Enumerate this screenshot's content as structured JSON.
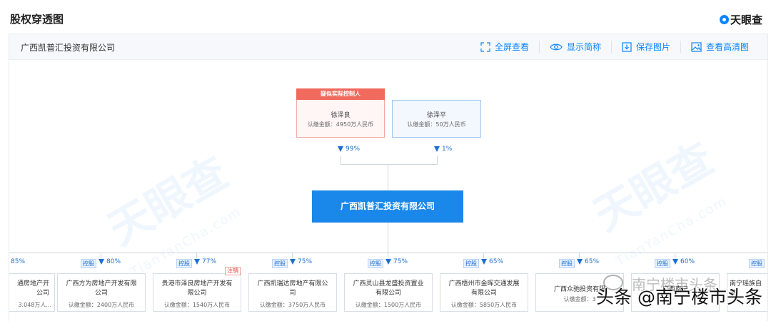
{
  "page": {
    "title": "股权穿透图",
    "brand": "天眼查"
  },
  "toolbar": {
    "company_name": "广西凯普汇投资有限公司",
    "fullscreen": "全屏查看",
    "show_abbr": "显示简称",
    "save_image": "保存图片",
    "hd_image": "查看高清图"
  },
  "watermarks": {
    "logo_text": "天眼查",
    "pinyin": "TianYanCha.com",
    "overlay": "头条 @南宁楼市头条",
    "ghost": "南宁楼市头条"
  },
  "shareholders": [
    {
      "tag": "疑似实际控制人",
      "name": "徐泽良",
      "amount": "认缴金额：4950万人民币",
      "percent": "99%"
    },
    {
      "name": "徐泽平",
      "amount": "认缴金额：50万人民币",
      "percent": "1%"
    }
  ],
  "main_company": {
    "name": "广西凯普汇投资有限公司"
  },
  "subsidiaries": {
    "control_label": "控股",
    "cancel_label": "注销",
    "items": [
      {
        "name": "通房地产开\n公司",
        "amount": "3.048万人...",
        "percent": "85%"
      },
      {
        "name": "广西方为房地产开发有限\n公司",
        "amount": "认缴金额：2400万人民币",
        "percent": "80%"
      },
      {
        "name": "贵港市泽良房地产开发有\n限公司",
        "amount": "认缴金额：1540万人民币",
        "percent": "77%"
      },
      {
        "name": "广西凯瑞达房地产有限公\n司",
        "amount": "认缴金额：3750万人民币",
        "percent": "75%"
      },
      {
        "name": "广西灵山县龙盛投资置业\n有限公司",
        "amount": "认缴金额：1500万人民币",
        "percent": "75%"
      },
      {
        "name": "广西梧州市金晖交通发展\n有限公司",
        "amount": "认缴金额：5850万人民币",
        "percent": "65%"
      },
      {
        "name": "广西众驰投资有限",
        "amount": "认缴金额：3",
        "percent": "65%"
      },
      {
        "name": "广西南宁",
        "amount": "",
        "percent": "60%"
      },
      {
        "name": "南宁瑶族自\n发",
        "amount": "",
        "percent": ""
      }
    ]
  },
  "colors": {
    "accent": "#1a87ea",
    "actual_controller": "#f06a5e",
    "link": "#0a84ff"
  }
}
